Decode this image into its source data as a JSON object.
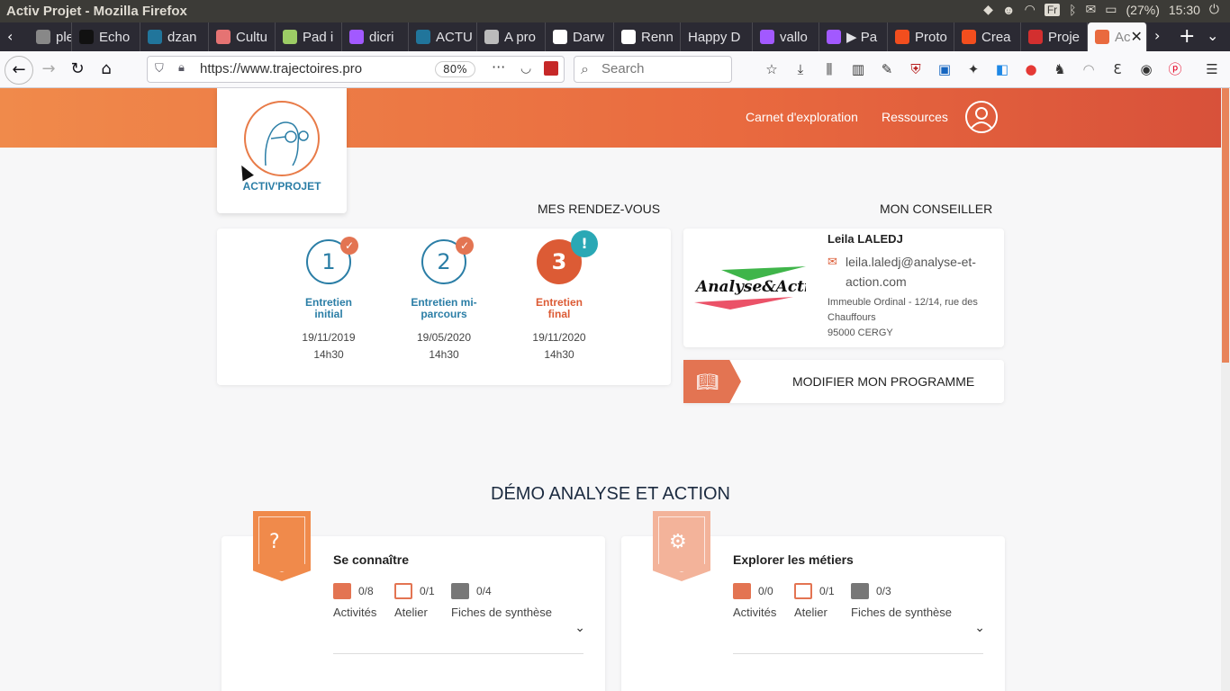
{
  "os": {
    "window_title": "Activ Projet - Mozilla Firefox",
    "lang": "Fr",
    "battery": "(27%)",
    "clock": "15:30"
  },
  "tabs": [
    {
      "label": "ple",
      "favicon_color": "#888"
    },
    {
      "label": "Echo",
      "favicon_color": "#111"
    },
    {
      "label": "dzan",
      "favicon_color": "#21759b"
    },
    {
      "label": "Cultu",
      "favicon_color": "#e57373"
    },
    {
      "label": "Pad i",
      "favicon_color": "#9ccc65"
    },
    {
      "label": "dicri",
      "favicon_color": "#a259ff"
    },
    {
      "label": "ACTU",
      "favicon_color": "#21759b"
    },
    {
      "label": "A pro",
      "favicon_color": "#bbb"
    },
    {
      "label": "Darw",
      "favicon_color": "#fff"
    },
    {
      "label": "Renn",
      "favicon_color": "#fff"
    },
    {
      "label": "Happy D",
      "favicon_color": ""
    },
    {
      "label": "vallo",
      "favicon_color": "#a259ff"
    },
    {
      "label": "▶ Pa",
      "favicon_color": "#a259ff"
    },
    {
      "label": "Proto",
      "favicon_color": "#f24e1e"
    },
    {
      "label": "Crea",
      "favicon_color": "#f24e1e"
    },
    {
      "label": "Proje",
      "favicon_color": "#d32f2f"
    },
    {
      "label": "Ac",
      "favicon_color": "#e96a3f"
    }
  ],
  "nav": {
    "url": "https://www.trajectoires.pro",
    "zoom": "80%",
    "search_placeholder": "Search"
  },
  "site": {
    "nav_links": [
      "Carnet d'exploration",
      "Ressources"
    ],
    "logo_text": "ACTIV'PROJET",
    "rdv_title": "MES RENDEZ-VOUS",
    "advisor_title": "MON CONSEILLER",
    "steps": [
      {
        "num": "1",
        "label_line1": "Entretien",
        "label_line2": "initial",
        "date": "19/11/2019",
        "time": "14h30",
        "status": "done"
      },
      {
        "num": "2",
        "label_line1": "Entretien mi-",
        "label_line2": "parcours",
        "date": "19/05/2020",
        "time": "14h30",
        "status": "done"
      },
      {
        "num": "3",
        "label_line1": "Entretien",
        "label_line2": "final",
        "date": "19/11/2020",
        "time": "14h30",
        "status": "current"
      }
    ],
    "done_badge": "✓",
    "alert_badge": "!",
    "advisor": {
      "company_logo": "Analyse&Action",
      "name": "Leila LALEDJ",
      "email_line1": "leila.laledj@analyse-et-",
      "email_line2": "action.com",
      "addr_line1": "Immeuble Ordinal - 12/14, rue des",
      "addr_line2": "Chauffours",
      "addr_line3": "95000 CERGY"
    },
    "modify_button": "MODIFIER MON PROGRAMME",
    "demo_title": "DÉMO ANALYSE ET ACTION",
    "modules": [
      {
        "title": "Se connaître",
        "ribbon_color": "#f08a4b",
        "stats": [
          {
            "value": "0/8",
            "label": "Activités"
          },
          {
            "value": "0/1",
            "label": "Atelier"
          },
          {
            "value": "0/4",
            "label": "Fiches de synthèse"
          }
        ]
      },
      {
        "title": "Explorer les métiers",
        "ribbon_color": "#f3b39a",
        "stats": [
          {
            "value": "0/0",
            "label": "Activités"
          },
          {
            "value": "0/1",
            "label": "Atelier"
          },
          {
            "value": "0/3",
            "label": "Fiches de synthèse"
          }
        ]
      }
    ]
  },
  "colors": {
    "accent": "#e96a3f",
    "primary_blue": "#2b7ea6",
    "alert_teal": "#2aa8b5"
  }
}
